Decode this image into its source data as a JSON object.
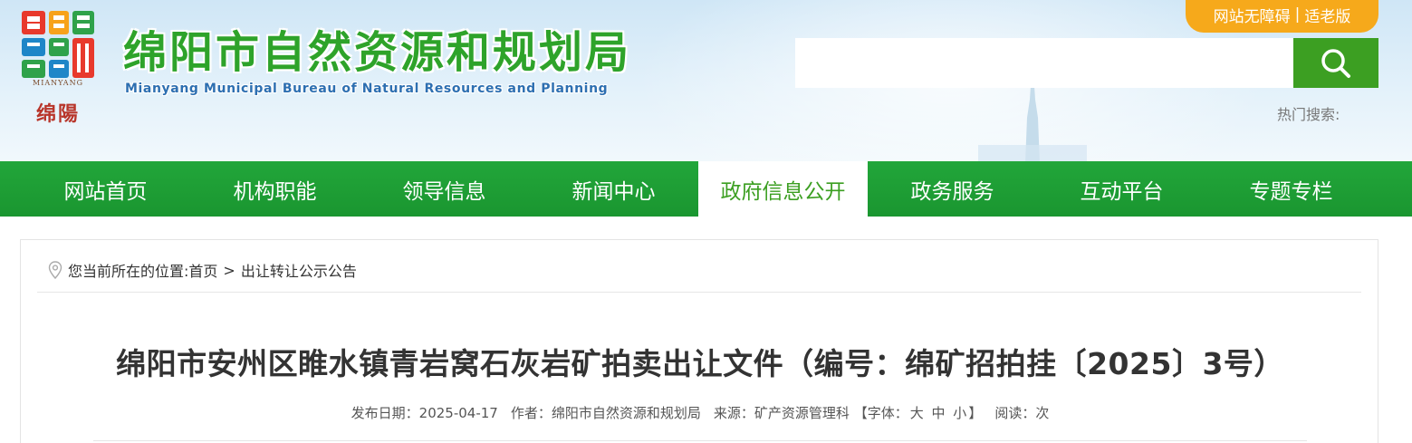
{
  "header": {
    "title": "绵阳市自然资源和规划局",
    "subtitle": "Mianyang Municipal Bureau of Natural Resources and Planning",
    "logo": {
      "en": "MIANYANG",
      "cn": "绵陽"
    },
    "accessibility": {
      "barrier_free": "网站无障碍",
      "separator": "|",
      "elder": "适老版"
    },
    "search": {
      "placeholder": "",
      "icon": "search-icon"
    },
    "hot_search_label": "热门搜索:"
  },
  "nav": {
    "items": [
      {
        "label": "网站首页",
        "active": false
      },
      {
        "label": "机构职能",
        "active": false
      },
      {
        "label": "领导信息",
        "active": false
      },
      {
        "label": "新闻中心",
        "active": false
      },
      {
        "label": "政府信息公开",
        "active": true
      },
      {
        "label": "政务服务",
        "active": false
      },
      {
        "label": "互动平台",
        "active": false
      },
      {
        "label": "专题专栏",
        "active": false
      }
    ]
  },
  "breadcrumb": {
    "prefix": "您当前所在的位置:",
    "home": "首页",
    "arrow": ">",
    "current": "出让转让公示公告"
  },
  "article": {
    "title": "绵阳市安州区睢水镇青岩窝石灰岩矿拍卖出让文件（编号：绵矿招拍挂〔2025〕3号）",
    "meta": {
      "date_label": "发布日期：",
      "date": "2025-04-17",
      "author_label": "作者：",
      "author": "绵阳市自然资源和规划局",
      "source_label": "来源：",
      "source": "矿产资源管理科",
      "font_label": "【字体：",
      "font_large": "大",
      "font_medium": "中",
      "font_small": "小",
      "font_close": "】",
      "views_label": "阅读：",
      "views_suffix": "次"
    }
  },
  "colors": {
    "brand_green": "#3c9f22",
    "nav_green": "#1f9f35",
    "accent_orange": "#f6a91b",
    "title_green": "#2ea32a",
    "subtitle_blue": "#2d6fb1"
  }
}
